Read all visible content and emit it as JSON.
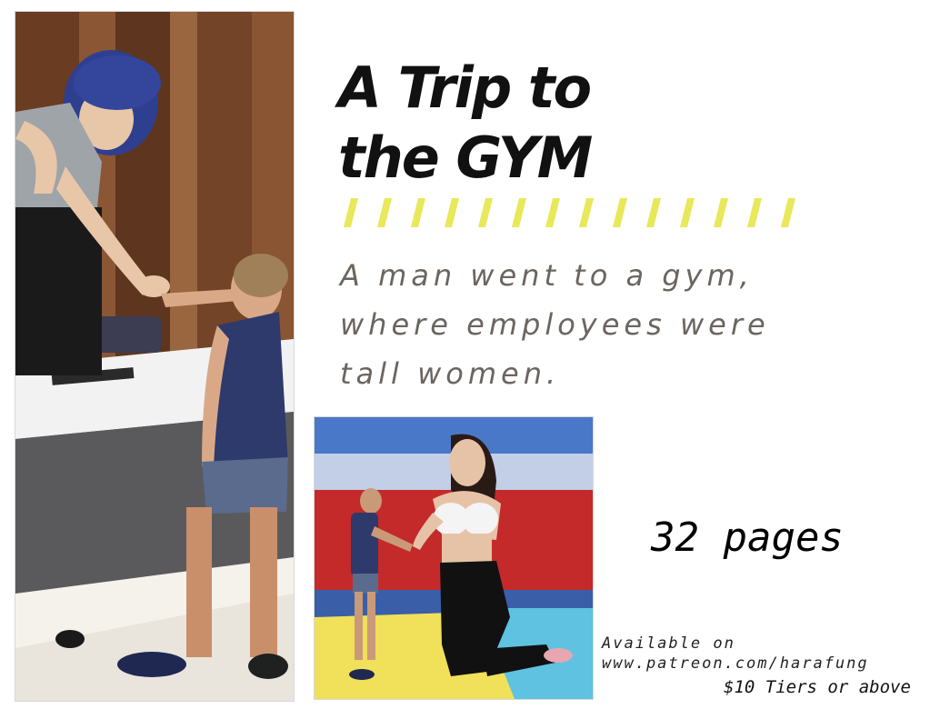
{
  "title": {
    "lines": [
      "A Trip to",
      "the GYM"
    ]
  },
  "divider": {
    "stripe_count": 14,
    "color": "#e8e85a"
  },
  "tagline": {
    "lines": [
      "A man went to a gym,",
      "where employees were",
      "tall women."
    ],
    "color": "#6b6560"
  },
  "pages": {
    "label": "32 pages"
  },
  "availability": {
    "line1": "Available on",
    "line2": "www.patreon.com/harafung",
    "tiers": "$10 Tiers or above"
  },
  "images": {
    "left": {
      "name": "cover-illustration-reception"
    },
    "small": {
      "name": "preview-illustration-handshake"
    }
  }
}
